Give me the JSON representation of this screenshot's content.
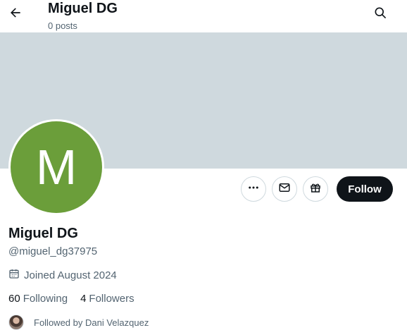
{
  "header": {
    "title": "Miguel DG",
    "subtitle": "0 posts",
    "back_icon": "arrow-left-icon",
    "search_icon": "search-icon"
  },
  "colors": {
    "banner": "#cfd9de",
    "avatar_bg": "#6b9e3a",
    "follow_bg": "#0f1419",
    "secondary_text": "#536471"
  },
  "profile": {
    "avatar_letter": "M",
    "name": "Miguel DG",
    "handle": "@miguel_dg37975",
    "joined": "Joined August 2024"
  },
  "actions": {
    "more_icon": "more-icon",
    "message_icon": "mail-icon",
    "gift_icon": "gift-icon",
    "follow_label": "Follow"
  },
  "stats": {
    "following_count": "60",
    "following_label": "Following",
    "followers_count": "4",
    "followers_label": "Followers"
  },
  "followed_by": {
    "text": "Followed by Dani Velazquez"
  }
}
